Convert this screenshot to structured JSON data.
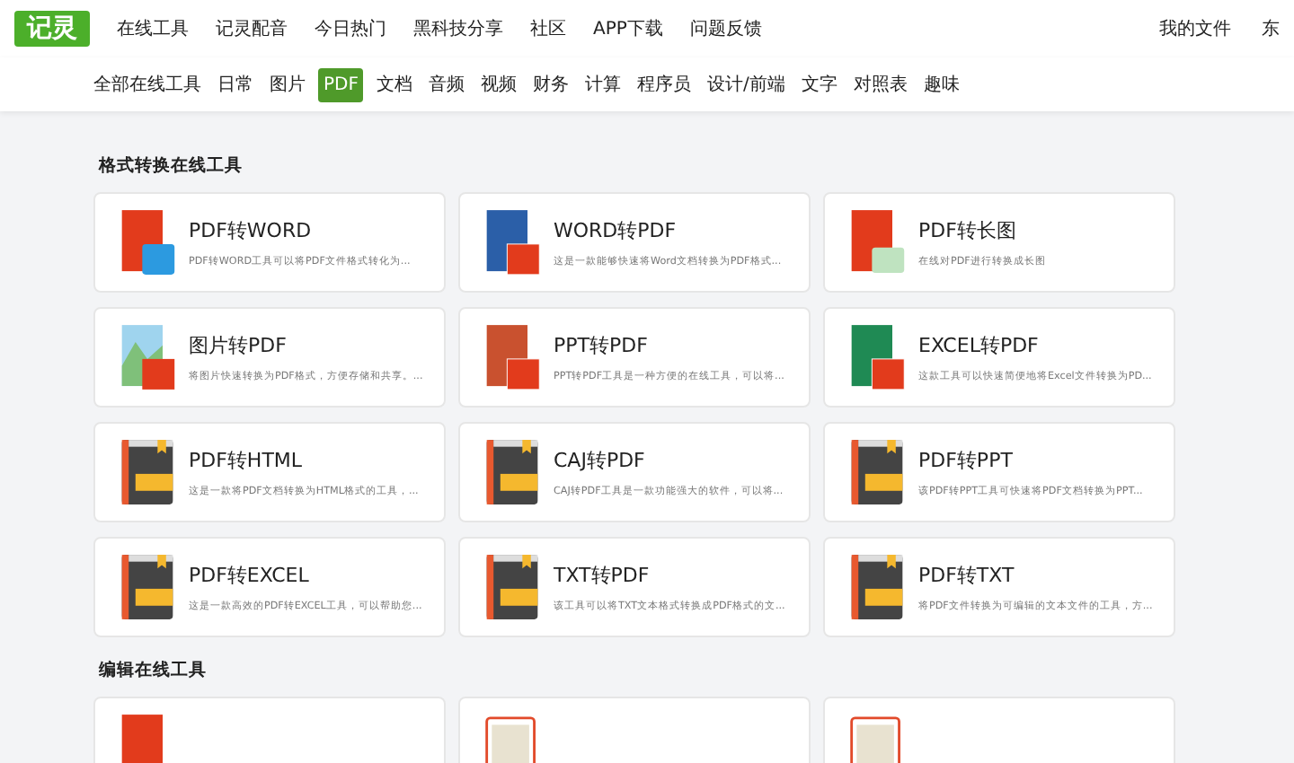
{
  "logo": "记灵",
  "nav": [
    {
      "label": "在线工具"
    },
    {
      "label": "记灵配音"
    },
    {
      "label": "今日热门"
    },
    {
      "label": "黑科技分享"
    },
    {
      "label": "社区"
    },
    {
      "label": "APP下载"
    },
    {
      "label": "问题反馈"
    }
  ],
  "nav_right": [
    "我的文件",
    "东"
  ],
  "categories": [
    {
      "label": "全部在线工具",
      "selected": false
    },
    {
      "label": "日常",
      "selected": false
    },
    {
      "label": "图片",
      "selected": false
    },
    {
      "label": "PDF",
      "selected": true
    },
    {
      "label": "文档",
      "selected": false
    },
    {
      "label": "音频",
      "selected": false
    },
    {
      "label": "视频",
      "selected": false
    },
    {
      "label": "财务",
      "selected": false
    },
    {
      "label": "计算",
      "selected": false
    },
    {
      "label": "程序员",
      "selected": false
    },
    {
      "label": "设计/前端",
      "selected": false
    },
    {
      "label": "文字",
      "selected": false
    },
    {
      "label": "对照表",
      "selected": false
    },
    {
      "label": "趣味",
      "selected": false
    }
  ],
  "sections": [
    {
      "title": "格式转换在线工具",
      "tools": [
        {
          "kind": "pdf-word",
          "title": "PDF转WORD",
          "description": "PDF转WORD工具可以将PDF文件格式转化为..."
        },
        {
          "kind": "doc-pdf",
          "title": "WORD转PDF",
          "description": "这是一款能够快速将Word文档转换为PDF格式..."
        },
        {
          "kind": "pdf-image",
          "title": "PDF转长图",
          "description": "在线对PDF进行转换成长图"
        },
        {
          "kind": "image-pdf",
          "title": "图片转PDF",
          "description": "将图片快速转换为PDF格式，方便存储和共享。..."
        },
        {
          "kind": "ppt-pdf",
          "title": "PPT转PDF",
          "description": "PPT转PDF工具是一种方便的在线工具，可以将..."
        },
        {
          "kind": "xls-pdf",
          "title": "EXCEL转PDF",
          "description": "这款工具可以快速简便地将Excel文件转换为PD..."
        },
        {
          "kind": "book",
          "title": "PDF转HTML",
          "description": "这是一款将PDF文档转换为HTML格式的工具，..."
        },
        {
          "kind": "book",
          "title": "CAJ转PDF",
          "description": "CAJ转PDF工具是一款功能强大的软件，可以将..."
        },
        {
          "kind": "book",
          "title": "PDF转PPT",
          "description": "该PDF转PPT工具可快速将PDF文档转换为PPT..."
        },
        {
          "kind": "book",
          "title": "PDF转EXCEL",
          "description": "这是一款高效的PDF转EXCEL工具，可以帮助您..."
        },
        {
          "kind": "book",
          "title": "TXT转PDF",
          "description": "该工具可以将TXT文本格式转换成PDF格式的文..."
        },
        {
          "kind": "book",
          "title": "PDF转TXT",
          "description": "将PDF文件转换为可编辑的文本文件的工具，方..."
        }
      ]
    },
    {
      "title": "编辑在线工具",
      "tools": [
        {
          "kind": "red"
        },
        {
          "kind": "frame"
        },
        {
          "kind": "frame"
        }
      ]
    }
  ]
}
